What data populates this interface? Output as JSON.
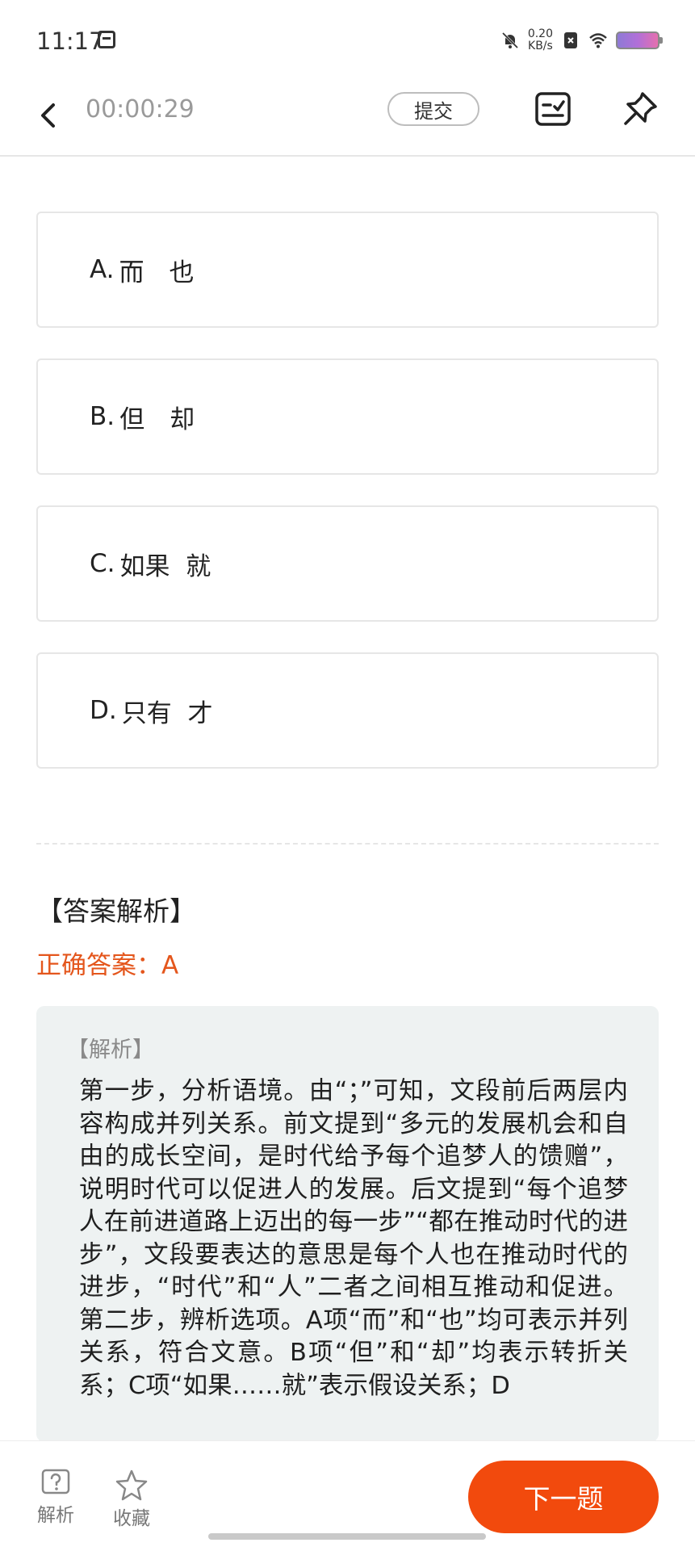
{
  "status_bar": {
    "time": "11:17",
    "net_speed_value": "0.20",
    "net_speed_unit": "KB/s"
  },
  "toolbar": {
    "timer": "00:00:29",
    "submit_label": "提交",
    "icons": [
      "back-arrow-icon",
      "answer-sheet-icon",
      "pin-icon"
    ]
  },
  "options": [
    {
      "letter": "A.",
      "text": "而　也"
    },
    {
      "letter": "B.",
      "text": "但　却"
    },
    {
      "letter": "C.",
      "text": "如果  就"
    },
    {
      "letter": "D.",
      "text": "只有  才"
    }
  ],
  "analysis": {
    "section_title": "【答案解析】",
    "correct_label": "正确答案：",
    "correct_value": "A",
    "box_heading": "【解析】",
    "body": "第一步，分析语境。由“；”可知，文段前后两层内容构成并列关系。前文提到“多元的发展机会和自由的成长空间，是时代给予每个追梦人的馈赠”，说明时代可以促进人的发展。后文提到“每个追梦人在前进道路上迈出的每一步”“都在推动时代的进步”，文段要表达的意思是每个人也在推动时代的进步，“时代”和“人”二者之间相互推动和促进。 第二步，辨析选项。A项“而”和“也”均可表示并列关系，符合文意。B项“但”和“却”均表示转折关系；C项“如果……就”表示假设关系；D"
  },
  "bottom_bar": {
    "analysis_label": "解析",
    "favorite_label": "收藏",
    "next_label": "下一题"
  },
  "colors": {
    "accent": "#f24a0d",
    "correct_text": "#e4561c",
    "explain_bg": "#eef2f2"
  }
}
